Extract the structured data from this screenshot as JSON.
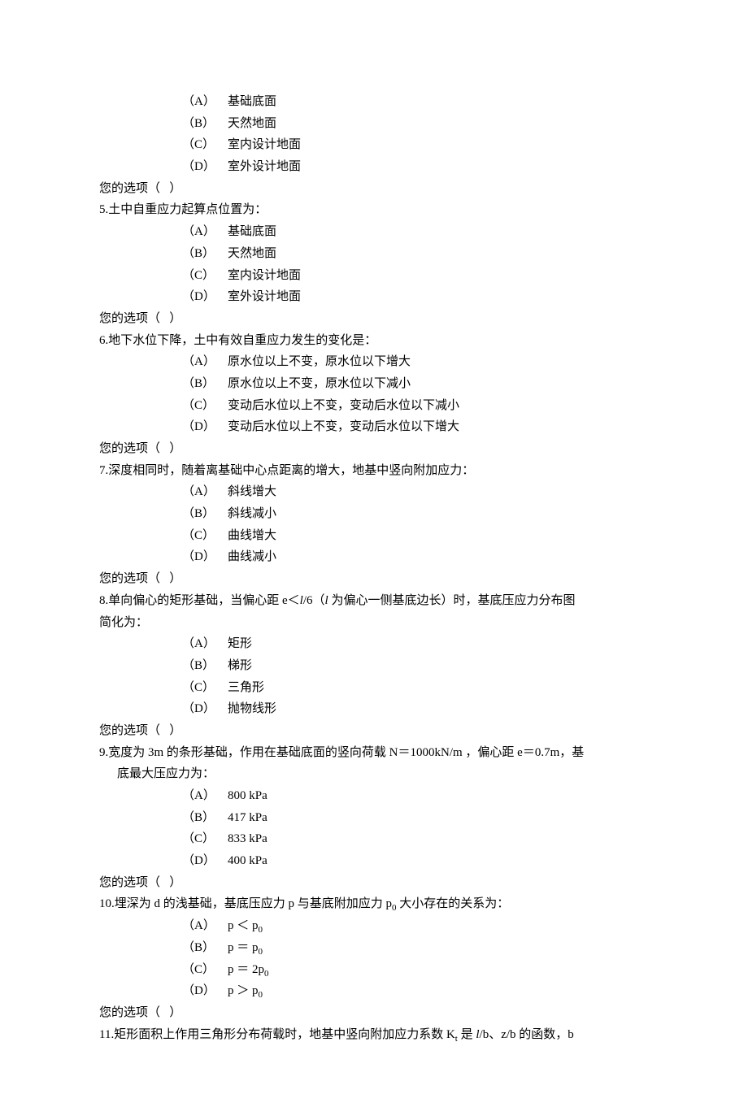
{
  "common": {
    "answer_prompt": "您的选项（   ）",
    "letters": {
      "A": "（A）",
      "B": "（B）",
      "C": "（C）",
      "D": "（D）"
    }
  },
  "prelude_options": {
    "A": "基础底面",
    "B": "天然地面",
    "C": "室内设计地面",
    "D": "室外设计地面"
  },
  "q5": {
    "stem": "5.土中自重应力起算点位置为：",
    "A": "基础底面",
    "B": "天然地面",
    "C": "室内设计地面",
    "D": "室外设计地面"
  },
  "q6": {
    "stem": "6.地下水位下降，土中有效自重应力发生的变化是：",
    "A": "原水位以上不变，原水位以下增大",
    "B": "原水位以上不变，原水位以下减小",
    "C": "变动后水位以上不变，变动后水位以下减小",
    "D": "变动后水位以上不变，变动后水位以下增大"
  },
  "q7": {
    "stem": "7.深度相同时，随着离基础中心点距离的增大，地基中竖向附加应力：",
    "A": "斜线增大",
    "B": "斜线减小",
    "C": "曲线增大",
    "D": "曲线减小"
  },
  "q8": {
    "stem_part1": "8.单向偏心的矩形基础，当偏心距 e＜",
    "stem_italic1": "l",
    "stem_part2": "/6（",
    "stem_italic2": "l",
    "stem_part3": " 为偏心一侧基底边长）时，基底压应力分布图",
    "stem_line2": "简化为：",
    "A": "矩形",
    "B": "梯形",
    "C": "三角形",
    "D": "抛物线形"
  },
  "q9": {
    "stem_line1": "9.宽度为 3m 的条形基础，作用在基础底面的竖向荷载 N＝1000kN/m ，偏心距 e＝0.7m，基",
    "stem_line2": "底最大压应力为：",
    "A": "800 kPa",
    "B": "417 kPa",
    "C": "833 kPa",
    "D": "400 kPa"
  },
  "q10": {
    "stem": "10.埋深为 d 的浅基础，基底压应力 p 与基底附加应力 p",
    "stem_sub": "0",
    "stem_tail": " 大小存在的关系为：",
    "A1": "p ＜ p",
    "A2": "0",
    "B1": "p ＝ p",
    "B2": "0",
    "C1": "p ＝ 2p",
    "C2": "0",
    "D1": "p ＞ p",
    "D2": "0"
  },
  "q11": {
    "stem_part1": "11.矩形面积上作用三角形分布荷载时，地基中竖向附加应力系数 K",
    "stem_sub": "t",
    "stem_part2": " 是 ",
    "stem_italic": "l",
    "stem_part3": "/b、z/b 的函数，b"
  }
}
